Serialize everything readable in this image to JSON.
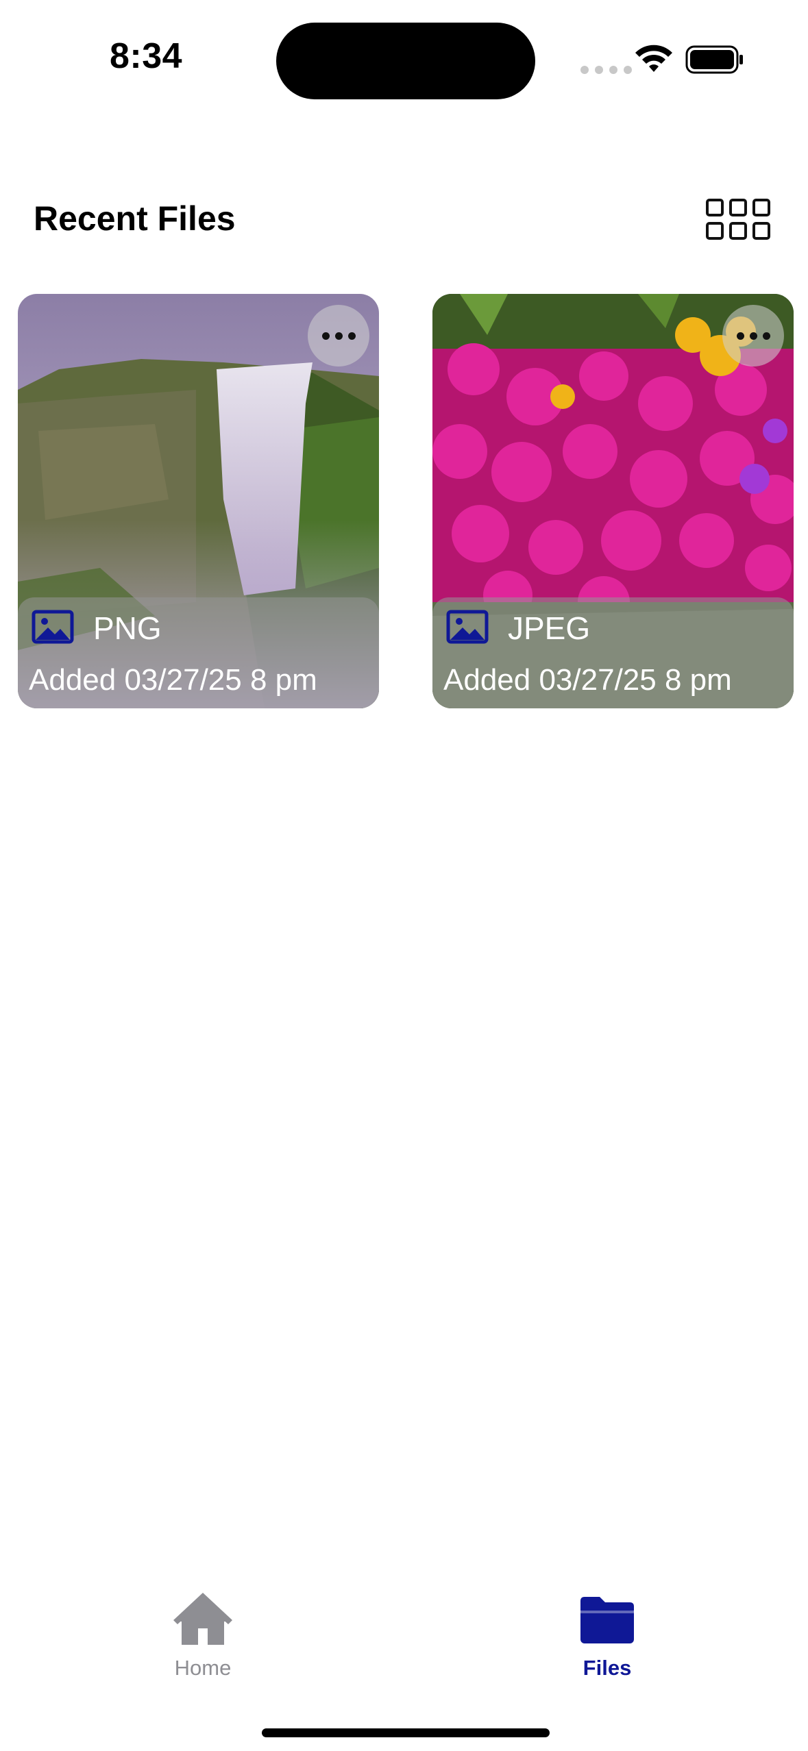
{
  "status_bar": {
    "time": "8:34"
  },
  "header": {
    "title": "Recent Files",
    "layout_toggle_icon": "grid-icon"
  },
  "files": [
    {
      "type": "PNG",
      "added": "Added 03/27/25 8 pm",
      "thumbnail": "waterfall-photo",
      "type_icon": "image-icon"
    },
    {
      "type": "JPEG",
      "added": "Added 03/27/25 8 pm",
      "thumbnail": "flowers-photo",
      "type_icon": "image-icon"
    }
  ],
  "tab_bar": {
    "tabs": [
      {
        "label": "Home",
        "icon": "home-icon",
        "selected": false
      },
      {
        "label": "Files",
        "icon": "folder-icon",
        "selected": true
      }
    ]
  },
  "colors": {
    "accent": "#0f1896",
    "inactive_tab": "#8e8e93"
  }
}
